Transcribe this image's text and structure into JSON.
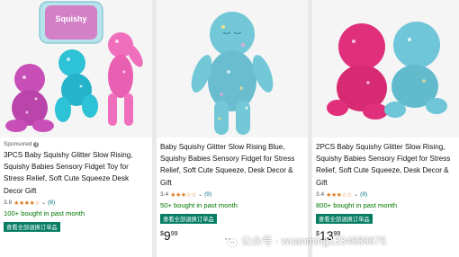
{
  "products": [
    {
      "sponsored": "Sponsored",
      "title": "3PCS Baby Squishy Glitter Slow Rising, Squishy Babies Sensory Fidget Toy for Stress Relief, Soft Cute Squeeze Desk Decor Gift",
      "rating": "3.8",
      "stars": "★★★★☆",
      "review_count": "(8)",
      "bought": "100+ bought in past month",
      "badge": "查看全部退换订单品",
      "image": {
        "box_text": "Squishy",
        "colors": [
          "#c94fb8",
          "#2ec2d6",
          "#ef6fbd"
        ]
      }
    },
    {
      "title": "Baby Squishy Glitter Slow Rising Blue, Squishy Babies Sensory Fidget for Stress Relief, Soft Cute Squeeze, Desk Decor & Gift",
      "rating": "3.4",
      "stars": "★★★☆☆",
      "review_count": "(9)",
      "bought": "50+ bought in past month",
      "badge": "查看全部退换订单品",
      "price": {
        "symbol": "$",
        "whole": "9",
        "fraction": "99"
      },
      "image": {
        "colors": [
          "#73c8d8"
        ]
      }
    },
    {
      "title": "2PCS Baby Squishy Glitter Slow Rising, Squishy Babies Sensory Fidget for Stress Relief, Soft Cute Squeeze, Desk Decor & Gift",
      "rating": "3.4",
      "stars": "★★★☆☆",
      "review_count": "(9)",
      "bought": "800+ bought in past month",
      "badge": "查看全部退换订单品",
      "price": {
        "symbol": "$",
        "whole": "13",
        "fraction": "99"
      },
      "image": {
        "colors": [
          "#e0307c",
          "#6ec6d8"
        ]
      }
    }
  ],
  "watermark": {
    "text": "公众号 · wuanming1334689675",
    "icon": "wechat-icon"
  }
}
